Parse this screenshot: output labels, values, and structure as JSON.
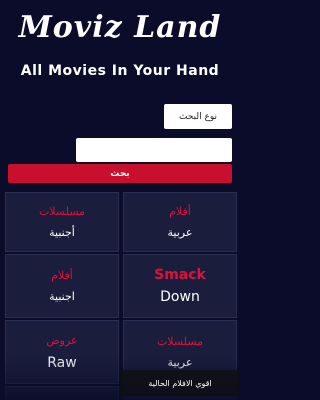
{
  "header": {
    "logo": "Moviz Land",
    "tagline": "All Movies In Your Hand"
  },
  "search": {
    "type_label": "نوع البحث",
    "input_value": "",
    "button_label": "بحث"
  },
  "categories": [
    {
      "line1": "مسلسلات",
      "line2": "أجنبية"
    },
    {
      "line1": "أفلام",
      "line2": "عربية"
    },
    {
      "line1": "أفلام",
      "line2": "اجنبية"
    },
    {
      "line1": "Smack",
      "line2": "Down"
    },
    {
      "line1": "عروض",
      "line2": "Raw"
    },
    {
      "line1": "مسلسلات",
      "line2": "عربية"
    }
  ],
  "toast": {
    "text": "اقوي الافلام الحالية"
  },
  "colors": {
    "background": "#0b0c2a",
    "accent": "#c8102e",
    "tile": "#1a1d3c"
  }
}
